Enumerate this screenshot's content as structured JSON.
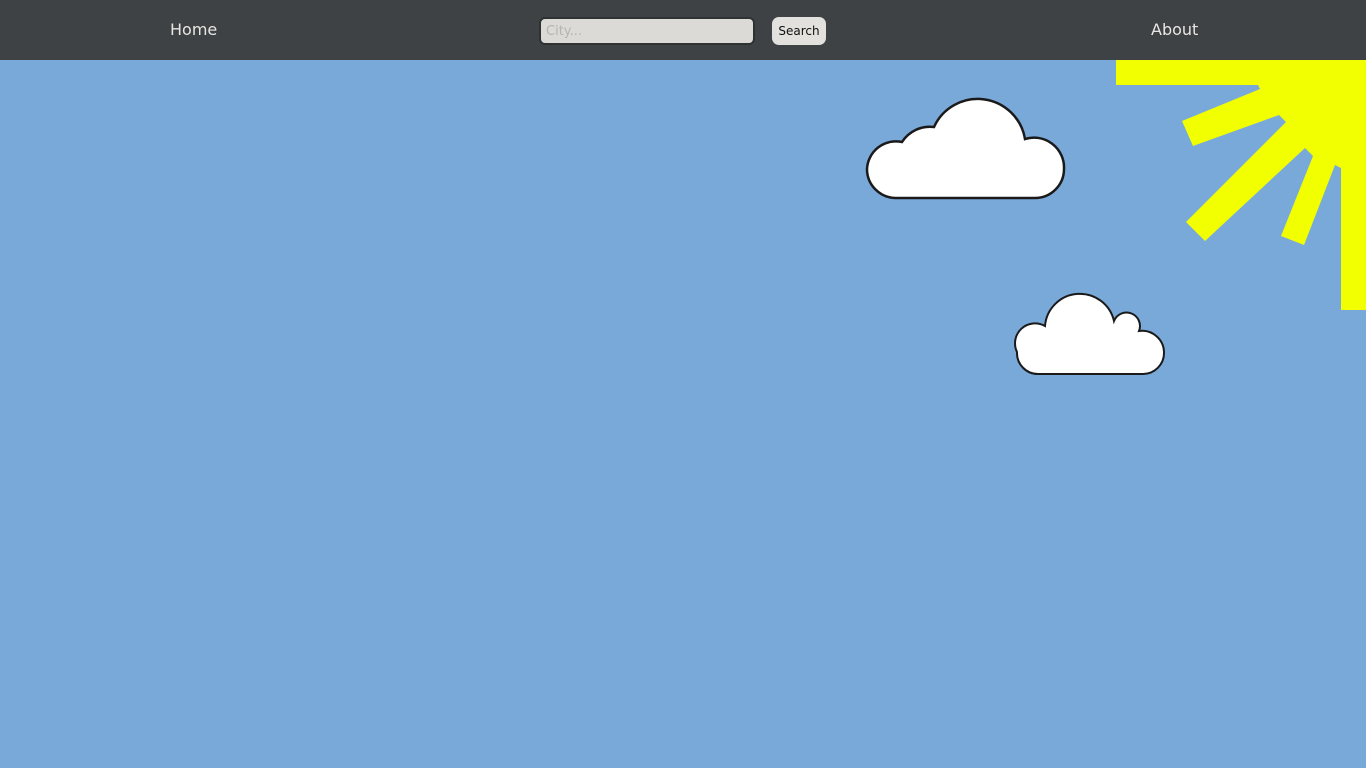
{
  "navbar": {
    "home_label": "Home",
    "about_label": "About",
    "search": {
      "placeholder": "City...",
      "value": "",
      "button_label": "Search"
    }
  },
  "scene": {
    "sky_color": "#79a9d9",
    "sun_color": "#f2ff00",
    "cloud_fill": "#ffffff",
    "cloud_stroke": "#1a1a1a",
    "icons": [
      "sun-icon",
      "cloud-icon",
      "cloud-icon"
    ]
  }
}
